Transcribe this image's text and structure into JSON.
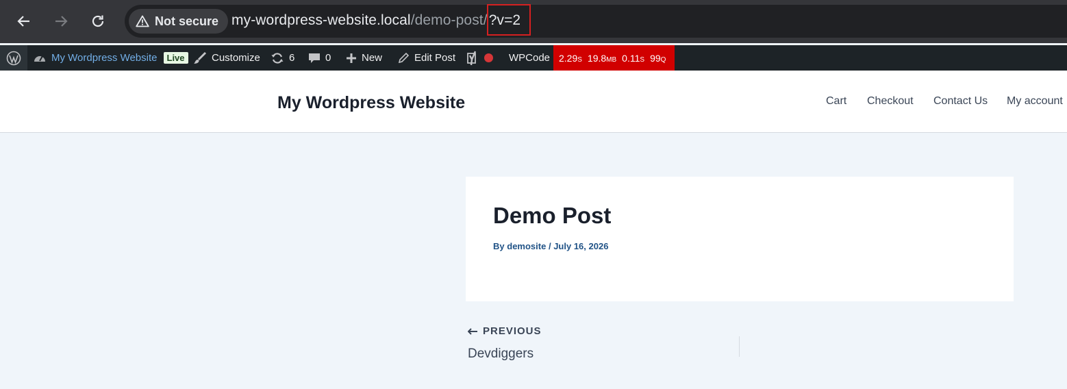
{
  "browser": {
    "security_label": "Not secure",
    "url_host": "my-wordpress-website.local",
    "url_path": "/demo-post/",
    "url_query": "?v=2",
    "icons": [
      "back-arrow-icon",
      "forward-arrow-icon",
      "reload-icon",
      "warning-icon"
    ]
  },
  "admin_bar": {
    "site_name": "My Wordpress Website",
    "live_badge": "Live",
    "customize": "Customize",
    "updates_count": "6",
    "comments_count": "0",
    "new_label": "New",
    "edit_post": "Edit Post",
    "wpcode": "WPCode",
    "perf": {
      "time": "2.29",
      "time_unit": "S",
      "memory": "19.8",
      "memory_unit": "MB",
      "query_time": "0.11",
      "query_time_unit": "S",
      "queries": "99",
      "queries_unit": "Q"
    },
    "colors": {
      "background": "#1d2327",
      "perf_background": "#d10000",
      "badge": "#e7f7e3"
    }
  },
  "site": {
    "title": "My Wordpress Website",
    "menu": [
      "Cart",
      "Checkout",
      "Contact Us",
      "My account"
    ]
  },
  "post": {
    "title": "Demo Post",
    "author_prefix": "By",
    "author": "demosite",
    "separator": "/",
    "date": "July 16, 2026"
  },
  "post_nav": {
    "previous_label": "PREVIOUS",
    "previous_title": "Devdiggers"
  }
}
